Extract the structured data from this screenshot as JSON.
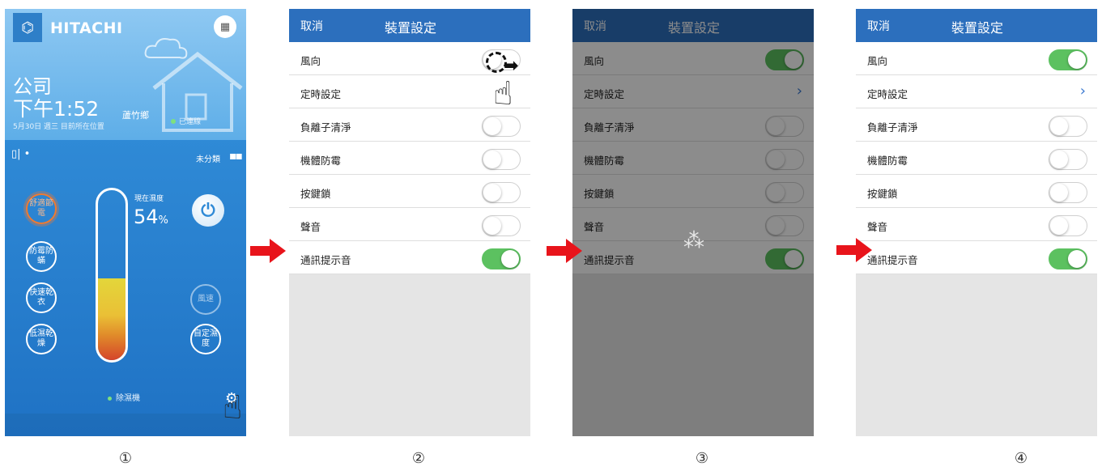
{
  "screen1": {
    "brand": "HITACHI",
    "place": "公司",
    "time": "下午1:52",
    "district": "蘆竹鄉",
    "date_line": "5月30日 週三  目前所在位置",
    "connection": "已連線",
    "uncategorized": "未分類",
    "humidity_label": "現在濕度",
    "humidity_value": "54",
    "humidity_unit": "%",
    "humidity_fraction": 0.48,
    "modes": {
      "comfort": "舒適節電",
      "mold": "防霉防蟎",
      "quick_dry": "快速乾衣",
      "low_humidity": "低濕乾燥",
      "fan_speed": "風速",
      "custom_humidity": "自定濕度"
    },
    "device": "除濕機"
  },
  "settings": {
    "cancel": "取消",
    "title": "裝置設定",
    "rows": [
      "風向",
      "定時設定",
      "負離子清淨",
      "機體防霉",
      "按鍵鎖",
      "聲音",
      "通訊提示音"
    ]
  },
  "steps": [
    "①",
    "②",
    "③",
    "④"
  ],
  "colors": {
    "header": "#2c6fbd",
    "toggle_on": "#5cc160",
    "arrow": "#e8141b"
  }
}
